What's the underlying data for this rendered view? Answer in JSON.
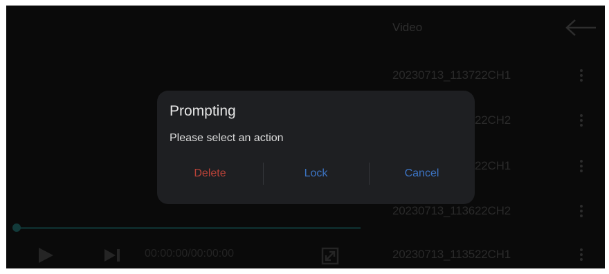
{
  "video_list": {
    "title": "Video",
    "items": [
      {
        "name": "20230713_113722CH1"
      },
      {
        "name": "20230713_113722CH2"
      },
      {
        "name": "20230713_113522CH1"
      },
      {
        "name": "20230713_113622CH2"
      },
      {
        "name": "20230713_113522CH1"
      }
    ]
  },
  "player": {
    "time": "00:00:00/00:00:00",
    "progress": 0
  },
  "dialog": {
    "title": "Prompting",
    "message": "Please select an action",
    "delete_label": "Delete",
    "lock_label": "Lock",
    "cancel_label": "Cancel"
  },
  "colors": {
    "background": "#0a0a0a",
    "dialog_bg": "#1e1f22",
    "delete": "#b84238",
    "accent": "#3c74c4"
  },
  "icons": {
    "back": "arrow-left-icon",
    "more": "more-vertical-icon",
    "play": "play-icon",
    "next": "skip-next-icon",
    "fullscreen": "fullscreen-icon"
  }
}
